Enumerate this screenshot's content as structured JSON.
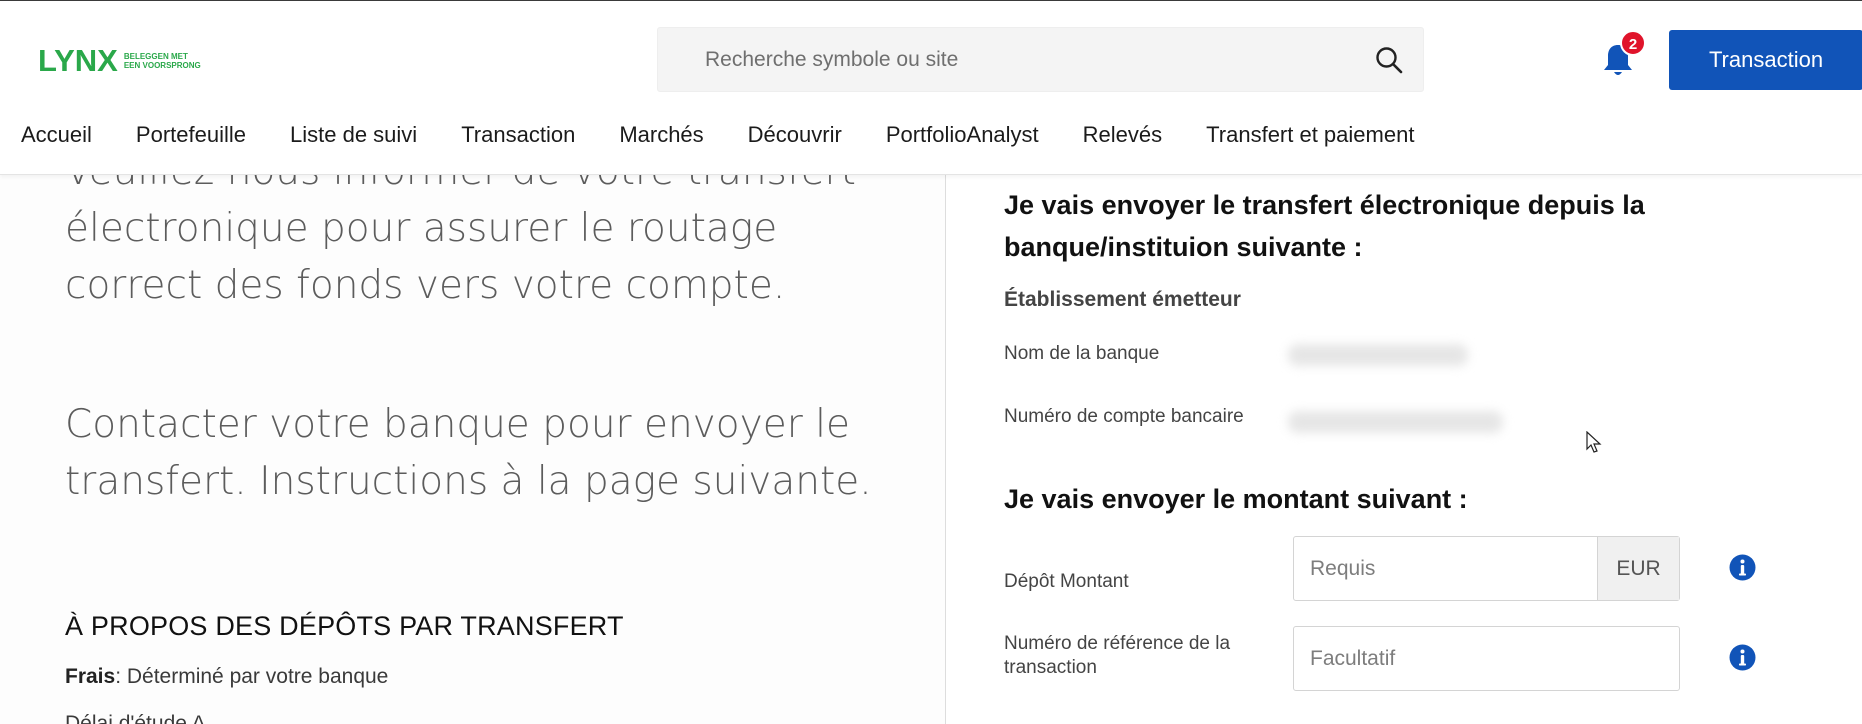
{
  "header": {
    "logo": {
      "wordmark": "LYNX",
      "tagline_line1": "BELEGGEN MET",
      "tagline_line2": "EEN VOORSPRONG"
    },
    "search": {
      "placeholder": "Recherche symbole ou site"
    },
    "notifications": {
      "count": "2"
    },
    "transaction_button": "Transaction"
  },
  "nav": {
    "items": [
      "Accueil",
      "Portefeuille",
      "Liste de suivi",
      "Transaction",
      "Marchés",
      "Découvrir",
      "PortfolioAnalyst",
      "Relevés",
      "Transfert et paiement"
    ]
  },
  "left": {
    "paragraph1": "Veuillez nous informer de votre transfert électronique pour assurer le routage correct des fonds vers votre compte.",
    "paragraph2": "Contacter votre banque pour envoyer le transfert. Instructions à la page suivante.",
    "about_title": "À PROPOS DES DÉPÔTS PAR TRANSFERT",
    "fees_label": "Frais",
    "fees_value": ": Déterminé par votre banque",
    "partial_line": "Délai d'étude A..."
  },
  "right": {
    "section1_title": "Je vais envoyer le transfert électronique depuis la banque/instituion suivante :",
    "issuer_heading": "Établissement émetteur",
    "bank_name_label": "Nom de la banque",
    "account_number_label": "Numéro de compte bancaire",
    "section2_title": "Je vais envoyer le montant suivant :",
    "amount_label": "Dépôt Montant",
    "amount_placeholder": "Requis",
    "currency": "EUR",
    "reference_label": "Numéro de référence de la transaction",
    "reference_placeholder": "Facultatif"
  },
  "colors": {
    "brand_green": "#2aa84a",
    "primary_blue": "#1154b8",
    "badge_red": "#e0142b"
  },
  "icons": [
    "search-icon",
    "bell-icon",
    "info-icon"
  ]
}
